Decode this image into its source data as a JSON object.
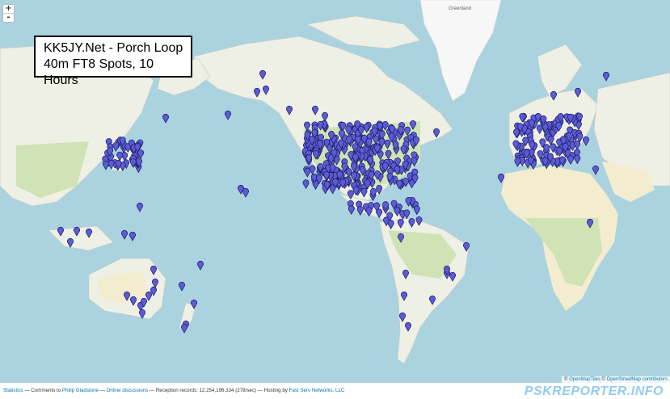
{
  "map": {
    "zoom_in_label": "+",
    "zoom_out_label": "-",
    "title_line1": "KK5JY.Net - Porch Loop",
    "title_line2": "40m FT8 Spots, 10 Hours",
    "greenland_label": "Greenland",
    "marker_color": "#5b5bd6",
    "marker_stroke": "#1c1c5e",
    "spots_icon": "spot-marker-icon",
    "attribution": {
      "prefix": "©",
      "tiles": "OpenMapTiles",
      "sep": " © ",
      "osm": "OpenStreetMap contributors"
    }
  },
  "footer": {
    "statistics": "Statistics",
    "comments": " — Comments to ",
    "author": "Philip Gladstone",
    "dash1": " — ",
    "discussions": "Online discussions",
    "records": " — Reception records: 12,254,196,334 (278/sec) — Hosting by ",
    "host": "Fast Serv Networks, LLC",
    "brand": "PSKREPORTER.INFO"
  }
}
